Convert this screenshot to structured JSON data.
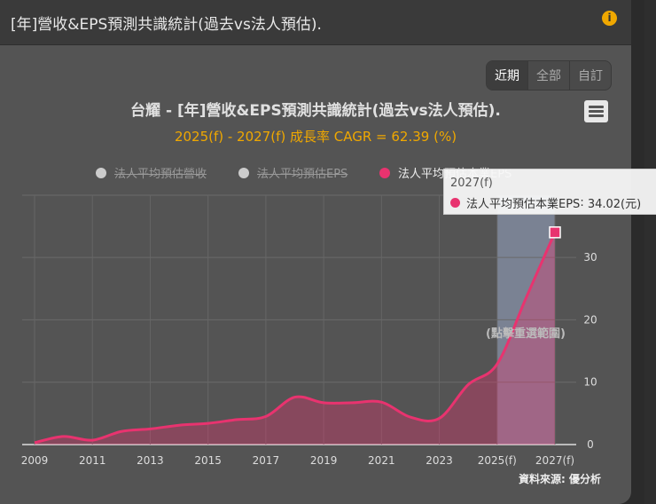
{
  "header": {
    "title": "[年]營收&EPS預測共識統計(過去vs法人預估).",
    "info_icon": "info-icon"
  },
  "range_buttons": [
    "近期",
    "全部",
    "自訂"
  ],
  "source": "資料來源: 優分析",
  "tooltip": {
    "category": "2027(f)",
    "series": "法人平均預估本業EPS",
    "value_text": "34.02(元)"
  },
  "reset_hint": "(點擊重選範圍)",
  "colors": {
    "accent": "#f0a800",
    "series": "#e8336f",
    "band": "#8792a8"
  },
  "chart_data": {
    "type": "area",
    "title": "台耀 - [年]營收&EPS預測共識統計(過去vs法人預估).",
    "subtitle": "2025(f) - 2027(f) 成長率 CAGR = 62.39 (%)",
    "legend": [
      {
        "name": "法人平均預估營收",
        "visible": false
      },
      {
        "name": "法人平均預估EPS",
        "visible": false
      },
      {
        "name": "法人平均預估本業EPS",
        "visible": true
      }
    ],
    "x": [
      2009,
      2010,
      2011,
      2012,
      2013,
      2014,
      2015,
      2016,
      2017,
      2018,
      2019,
      2020,
      2021,
      2022,
      2023,
      2024,
      2025,
      2026,
      2027
    ],
    "x_tick_labels": [
      "2009",
      "2011",
      "2013",
      "2015",
      "2017",
      "2019",
      "2021",
      "2023",
      "2025(f)",
      "2027(f)"
    ],
    "series": [
      {
        "name": "法人平均預估本業EPS",
        "values": [
          0.3,
          1.3,
          0.7,
          2.1,
          2.5,
          3.1,
          3.4,
          4.0,
          4.5,
          7.6,
          6.7,
          6.7,
          6.8,
          4.4,
          4.2,
          9.6,
          12.9,
          23.5,
          34.02
        ]
      }
    ],
    "y_ticks": [
      "0",
      "10",
      "20",
      "30"
    ],
    "ylim": [
      0,
      40
    ],
    "highlight_range": [
      2025,
      2027
    ],
    "grid": true
  }
}
